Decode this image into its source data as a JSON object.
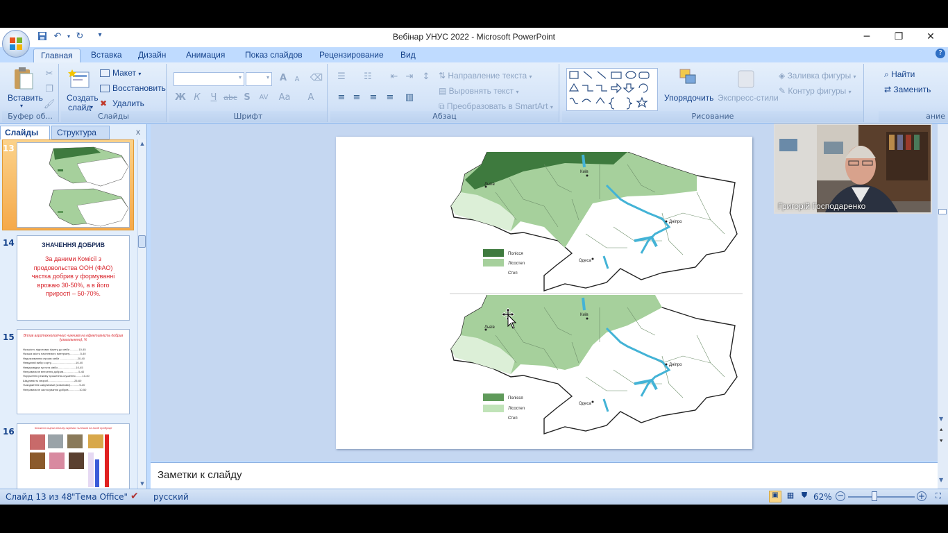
{
  "window": {
    "title": "Вебінар УНУС 2022 - Microsoft PowerPoint",
    "minimize_icon": "minimize-icon",
    "restore_icon": "restore-icon",
    "close_icon": "close-icon"
  },
  "tabs": [
    "Главная",
    "Вставка",
    "Дизайн",
    "Анимация",
    "Показ слайдов",
    "Рецензирование",
    "Вид"
  ],
  "ribbon": {
    "clipboard": {
      "label": "Буфер об...",
      "paste": "Вставить"
    },
    "slides": {
      "label": "Слайды",
      "new_slide_1": "Создать",
      "new_slide_2": "слайд",
      "layout": "Макет",
      "reset": "Восстановить",
      "delete": "Удалить"
    },
    "font": {
      "label": "Шрифт",
      "bold": "Ж",
      "italic": "К",
      "underline": "Ч",
      "strike": "abc",
      "shadow": "S",
      "spacing": "AV",
      "case": "Aa",
      "color": "A",
      "grow": "A",
      "shrink": "A"
    },
    "paragraph": {
      "label": "Абзац",
      "text_direction": "Направление текста",
      "align_text": "Выровнять текст",
      "smartart": "Преобразовать в SmartArt"
    },
    "drawing": {
      "label": "Рисование",
      "arrange": "Упорядочить",
      "quick_styles": "Экспресс-стили",
      "shape_fill": "Заливка фигуры",
      "shape_outline": "Контур фигуры"
    },
    "editing": {
      "label": "ание",
      "find": "Найти",
      "replace": "Заменить"
    }
  },
  "panel": {
    "tab_slides": "Слайды",
    "tab_outline": "Структура",
    "close": "x",
    "thumbs": [
      {
        "num": "13"
      },
      {
        "num": "14",
        "title": "ЗНАЧЕННЯ ДОБРИВ",
        "body": "За даними Комісії з продовольства ООН (ФАО) частка добрив у формуванні врожаю 30-50%, а в його прирості – 50-70%."
      },
      {
        "num": "15",
        "title": "Вплив агротехнологічних чинників на ефективність добрив (узагальнено), %",
        "lines": [
          "Низькість підготовки ґрунту до сівби ...........10-45",
          "Низька якість насіннєвого матеріалу..............5-40",
          "Недотримання строків сівби .......................20-40",
          "Невдалий вибір сорту................................10-40",
          "Невідповідна густота сівби........................10-45",
          "Неправильне внесення добрив....................5-40",
          "Порушення режиму зрошення-осушення.........10-40",
          "Шкідливість хвороб..................................25-60",
          "Ушкодження шкідниками (комахами)............5-40",
          "Неправильне застосування добрив..............10-50"
        ]
      },
      {
        "num": "16",
        "title": "Кількісна оцінка впливу окремих чинників на вихід продукції"
      }
    ]
  },
  "slide": {
    "legend_top": [
      "Полісся",
      "Лісостеп",
      "Степ"
    ],
    "legend_bottom": [
      "Полісся",
      "Лісостеп",
      "Степ"
    ],
    "cities": [
      "Київ",
      "Львів",
      "Дніпро",
      "Одеса"
    ]
  },
  "notes": {
    "placeholder": "Заметки к слайду"
  },
  "status": {
    "slide_info": "Слайд 13 из 48",
    "theme": "\"Тема Office\"",
    "language": "русский",
    "zoom": "62%",
    "zoom_fraction": 0.4
  },
  "video": {
    "name": "Григорій Господаренко"
  },
  "colors": {
    "polissia": "#3e7a3e",
    "lisostep": "#9fce96",
    "step": "#ffffff",
    "accent": "#15428b"
  }
}
